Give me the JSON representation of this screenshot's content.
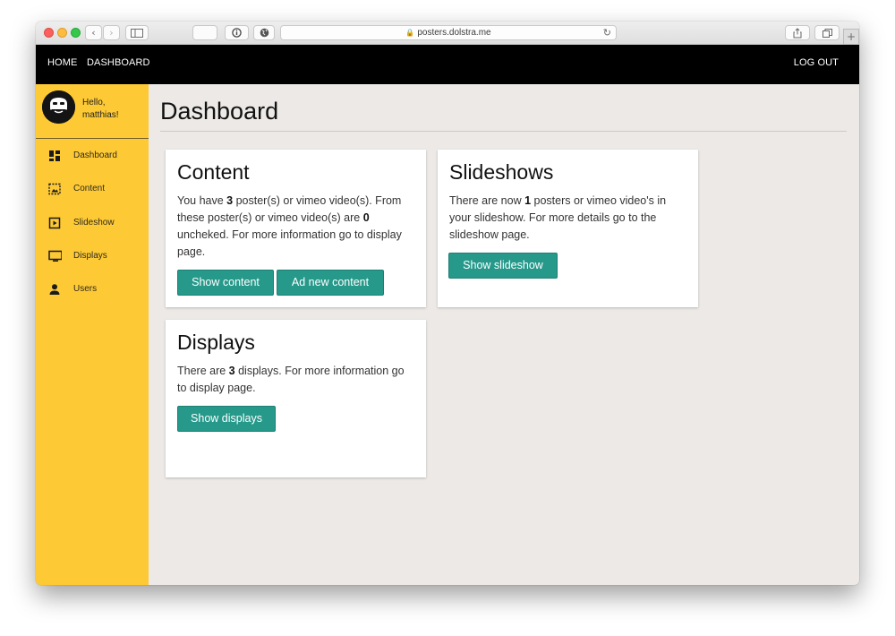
{
  "browser": {
    "url": "posters.dolstra.me"
  },
  "nav": {
    "home": "HOME",
    "dashboard": "DASHBOARD",
    "logout": "LOG OUT"
  },
  "sidebar": {
    "greeting_line1": "Hello,",
    "greeting_line2": "matthias!",
    "items": [
      {
        "label": "Dashboard",
        "icon": "dashboard-icon"
      },
      {
        "label": "Content",
        "icon": "content-icon"
      },
      {
        "label": "Slideshow",
        "icon": "slideshow-icon"
      },
      {
        "label": "Displays",
        "icon": "monitor-icon"
      },
      {
        "label": "Users",
        "icon": "user-icon"
      }
    ]
  },
  "main": {
    "title": "Dashboard",
    "cards": {
      "content": {
        "title": "Content",
        "t1": "You have ",
        "posters": "3",
        "t2": " poster(s) or vimeo video(s). From these poster(s) or vimeo video(s) are ",
        "unchecked": "0",
        "t3": " uncheked. For more information go to display page.",
        "btn_show": "Show content",
        "btn_add": "Ad new content"
      },
      "slideshows": {
        "title": "Slideshows",
        "t1": "There are now ",
        "count": "1",
        "t2": " posters or vimeo video's in your slideshow. For more details go to the slideshow page.",
        "btn_show": "Show slideshow"
      },
      "displays": {
        "title": "Displays",
        "t1": "There are ",
        "count": "3",
        "t2": " displays. For more information go to display page.",
        "btn_show": "Show displays"
      }
    }
  },
  "colors": {
    "sidebar": "#fdc934",
    "nav": "#000000",
    "button": "#26998b",
    "background": "#ece9e6"
  }
}
